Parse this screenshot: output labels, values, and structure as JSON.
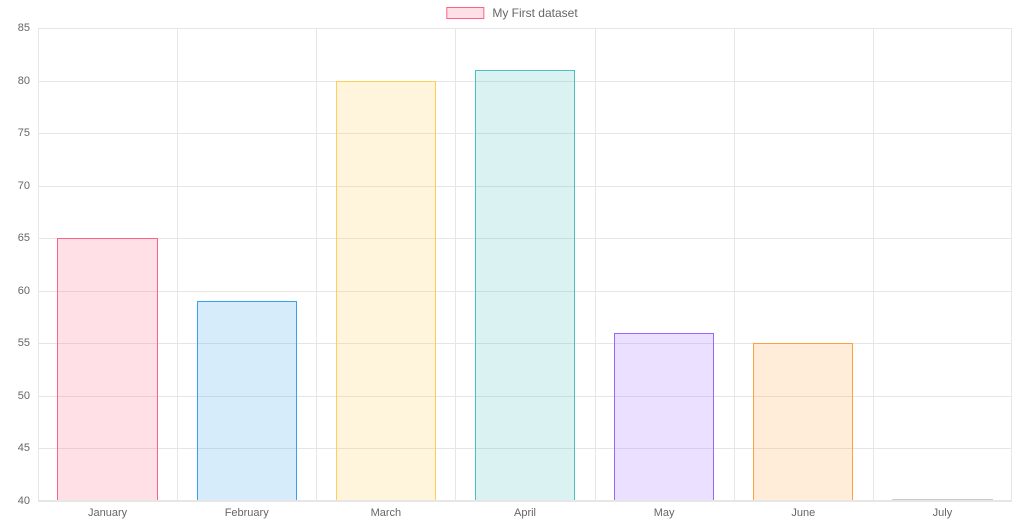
{
  "chart_data": {
    "type": "bar",
    "categories": [
      "January",
      "February",
      "March",
      "April",
      "May",
      "June",
      "July"
    ],
    "values": [
      65,
      59,
      80,
      81,
      56,
      55,
      40
    ],
    "series_name": "My First dataset",
    "ylim": [
      40,
      85
    ],
    "y_step": 5,
    "legend_position": "top",
    "grid": true,
    "bar_colors": [
      {
        "fill": "rgba(255,99,132,0.2)",
        "border": "rgb(255,99,132)"
      },
      {
        "fill": "rgba(54,162,235,0.2)",
        "border": "rgb(54,162,235)"
      },
      {
        "fill": "rgba(255,206,86,0.2)",
        "border": "rgb(255,206,86)"
      },
      {
        "fill": "rgba(75,192,192,0.2)",
        "border": "rgb(75,192,192)"
      },
      {
        "fill": "rgba(153,102,255,0.2)",
        "border": "rgb(153,102,255)"
      },
      {
        "fill": "rgba(255,159,64,0.2)",
        "border": "rgb(255,159,64)"
      },
      {
        "fill": "rgba(201,203,207,0.2)",
        "border": "rgb(201,203,207)"
      }
    ]
  }
}
